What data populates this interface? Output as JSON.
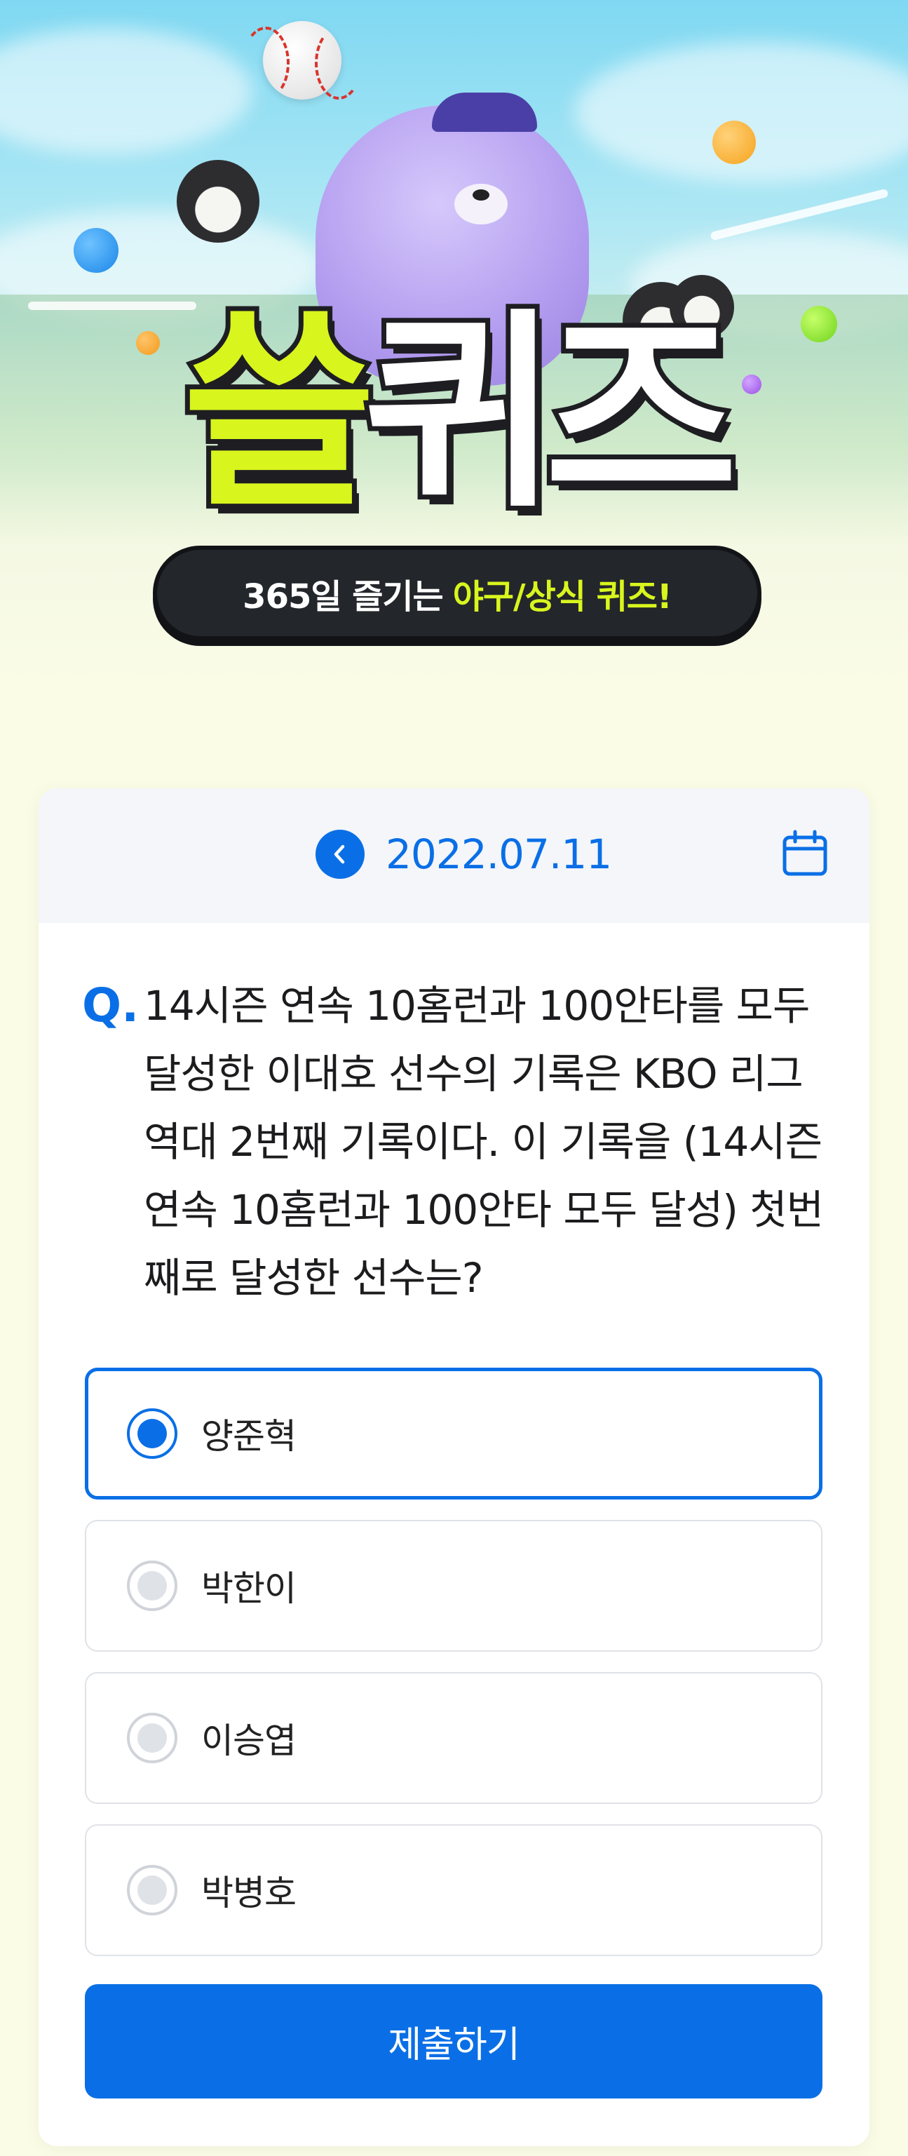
{
  "hero": {
    "title_part1": "쓸",
    "title_part2": "퀴즈",
    "subtitle_prefix": "365일 즐기는",
    "subtitle_highlight": "야구/상식 퀴즈!"
  },
  "date_bar": {
    "date": "2022.07.11",
    "prev_icon": "chevron-left-icon",
    "calendar_icon": "calendar-icon"
  },
  "question": {
    "marker": "Q.",
    "text": "14시즌 연속 10홈런과 100안타를 모두 달성한 이대호 선수의 기록은 KBO 리그 역대 2번째 기록이다. 이 기록을 (14시즌 연속 10홈런과 100안타 모두 달성) 첫번째로 달성한 선수는?"
  },
  "options": [
    {
      "label": "양준혁",
      "selected": true
    },
    {
      "label": "박한이",
      "selected": false
    },
    {
      "label": "이승엽",
      "selected": false
    },
    {
      "label": "박병호",
      "selected": false
    }
  ],
  "submit_label": "제출하기",
  "colors": {
    "accent": "#0a6fe6",
    "title_lime": "#d8f51e",
    "pill_dark": "#23262b"
  }
}
